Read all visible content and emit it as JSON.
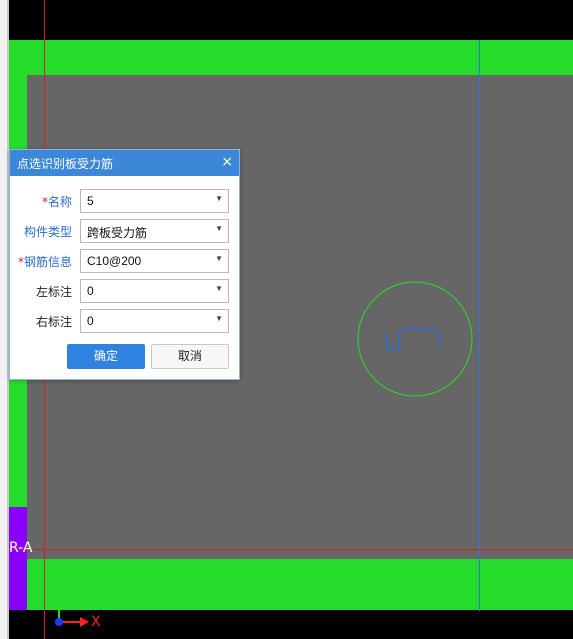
{
  "dialog": {
    "title": "点选识别板受力筋",
    "close_glyph": "×",
    "fields": [
      {
        "label": "名称",
        "required": true,
        "label_color": "blue",
        "value": "5"
      },
      {
        "label": "构件类型",
        "required": false,
        "label_color": "blue",
        "value": "跨板受力筋"
      },
      {
        "label": "钢筋信息",
        "required": true,
        "label_color": "blue",
        "value": "C10@200"
      },
      {
        "label": "左标注",
        "required": false,
        "label_color": "black",
        "value": "0"
      },
      {
        "label": "右标注",
        "required": false,
        "label_color": "black",
        "value": "0"
      }
    ],
    "ok_label": "确定",
    "cancel_label": "取消"
  },
  "canvas": {
    "axis_label": "R-A",
    "ucs_x_label": "X",
    "colors": {
      "beam": "#26dc2a",
      "slab": "#666666",
      "background": "#000000",
      "axis_red": "#d02020",
      "axis_blue": "#2a78e0",
      "purple": "#8a00ff",
      "selection_circle": "#26dc2a",
      "rebar_symbol": "#2a6cd8"
    }
  }
}
